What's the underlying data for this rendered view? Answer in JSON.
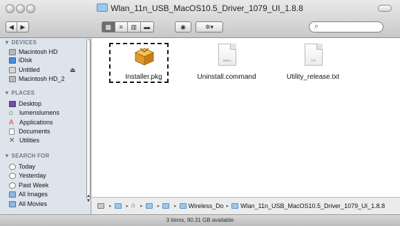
{
  "window": {
    "title": "Wlan_11n_USB_MacOS10.5_Driver_1079_UI_1.8.8"
  },
  "toolbar": {
    "back_icon": "◀",
    "forward_icon": "▶",
    "view_icons": [
      "▦",
      "≡",
      "▥",
      "▬"
    ],
    "quicklook_icon": "◉",
    "action_icon": "✲▾",
    "search_glyph": "⌕",
    "search_placeholder": ""
  },
  "sidebar": {
    "sections": [
      {
        "heading": "▼ DEVICES",
        "items": [
          {
            "label": "Macintosh HD",
            "icon": "hard-drive-icon"
          },
          {
            "label": "iDisk",
            "icon": "idisk-icon"
          },
          {
            "label": "Untitled",
            "icon": "disk-icon",
            "eject": "⏏"
          },
          {
            "label": "Macintosh HD_2",
            "icon": "hard-drive-icon"
          }
        ]
      },
      {
        "heading": "▼ PLACES",
        "items": [
          {
            "label": "Desktop",
            "icon": "desktop-icon"
          },
          {
            "label": "lumenslumens",
            "icon": "home-icon"
          },
          {
            "label": "Applications",
            "icon": "applications-icon"
          },
          {
            "label": "Documents",
            "icon": "documents-icon"
          },
          {
            "label": "Utilities",
            "icon": "utilities-icon"
          }
        ]
      },
      {
        "heading": "▼ SEARCH FOR",
        "items": [
          {
            "label": "Today",
            "icon": "clock-icon"
          },
          {
            "label": "Yesterday",
            "icon": "clock-icon"
          },
          {
            "label": "Past Week",
            "icon": "clock-icon"
          },
          {
            "label": "All Images",
            "icon": "smart-folder-icon"
          },
          {
            "label": "All Movies",
            "icon": "smart-folder-icon"
          }
        ]
      }
    ]
  },
  "files": [
    {
      "name": "Installer.pkg",
      "type": "package",
      "selected": true
    },
    {
      "name": "Uninstall.command",
      "type": "shell",
      "tag": "SHELL"
    },
    {
      "name": "Utility_release.txt",
      "type": "text",
      "tag": "TXT"
    }
  ],
  "pathbar": {
    "crumbs": [
      "",
      "",
      "",
      "",
      "",
      "Wireless_Do",
      "Wlan_11n_USB_MacOS10.5_Driver_1079_UI_1.8.8"
    ],
    "separator": "▸"
  },
  "status": {
    "text": "3 items, 90.31 GB available"
  }
}
